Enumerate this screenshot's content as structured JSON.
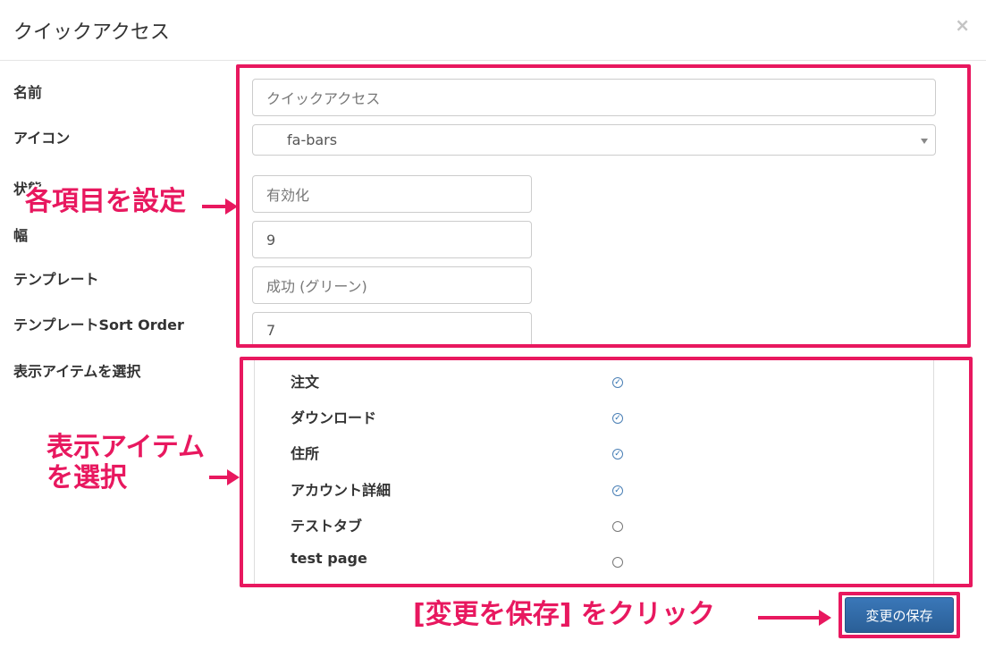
{
  "modal": {
    "title": "クイックアクセス",
    "close_glyph": "×"
  },
  "form": {
    "labels": {
      "name": "名前",
      "icon": "アイコン",
      "status": "状態",
      "width": "幅",
      "template": "テンプレート",
      "sort_order": "テンプレートSort Order",
      "items": "表示アイテムを選択"
    },
    "name_value": "クイックアクセス",
    "icon_value": "fa-bars",
    "status_value": "有効化",
    "width_value": "9",
    "template_value": "成功 (グリーン)",
    "sort_order_value": "7"
  },
  "items": [
    {
      "label": "注文",
      "checked": true
    },
    {
      "label": "ダウンロード",
      "checked": true
    },
    {
      "label": "住所",
      "checked": true
    },
    {
      "label": "アカウント詳細",
      "checked": true
    },
    {
      "label": "テストタブ",
      "checked": false
    },
    {
      "label": "test page",
      "checked": false
    }
  ],
  "footer": {
    "save_label": "変更の保存"
  },
  "annotations": {
    "set_items": "各項目を設定",
    "select_items_line1": "表示アイテム",
    "select_items_line2": "を選択",
    "click_save": "[変更を保存] をクリック"
  },
  "colors": {
    "annotation": "#e8185f",
    "primary_button": "#2f6aa6"
  }
}
